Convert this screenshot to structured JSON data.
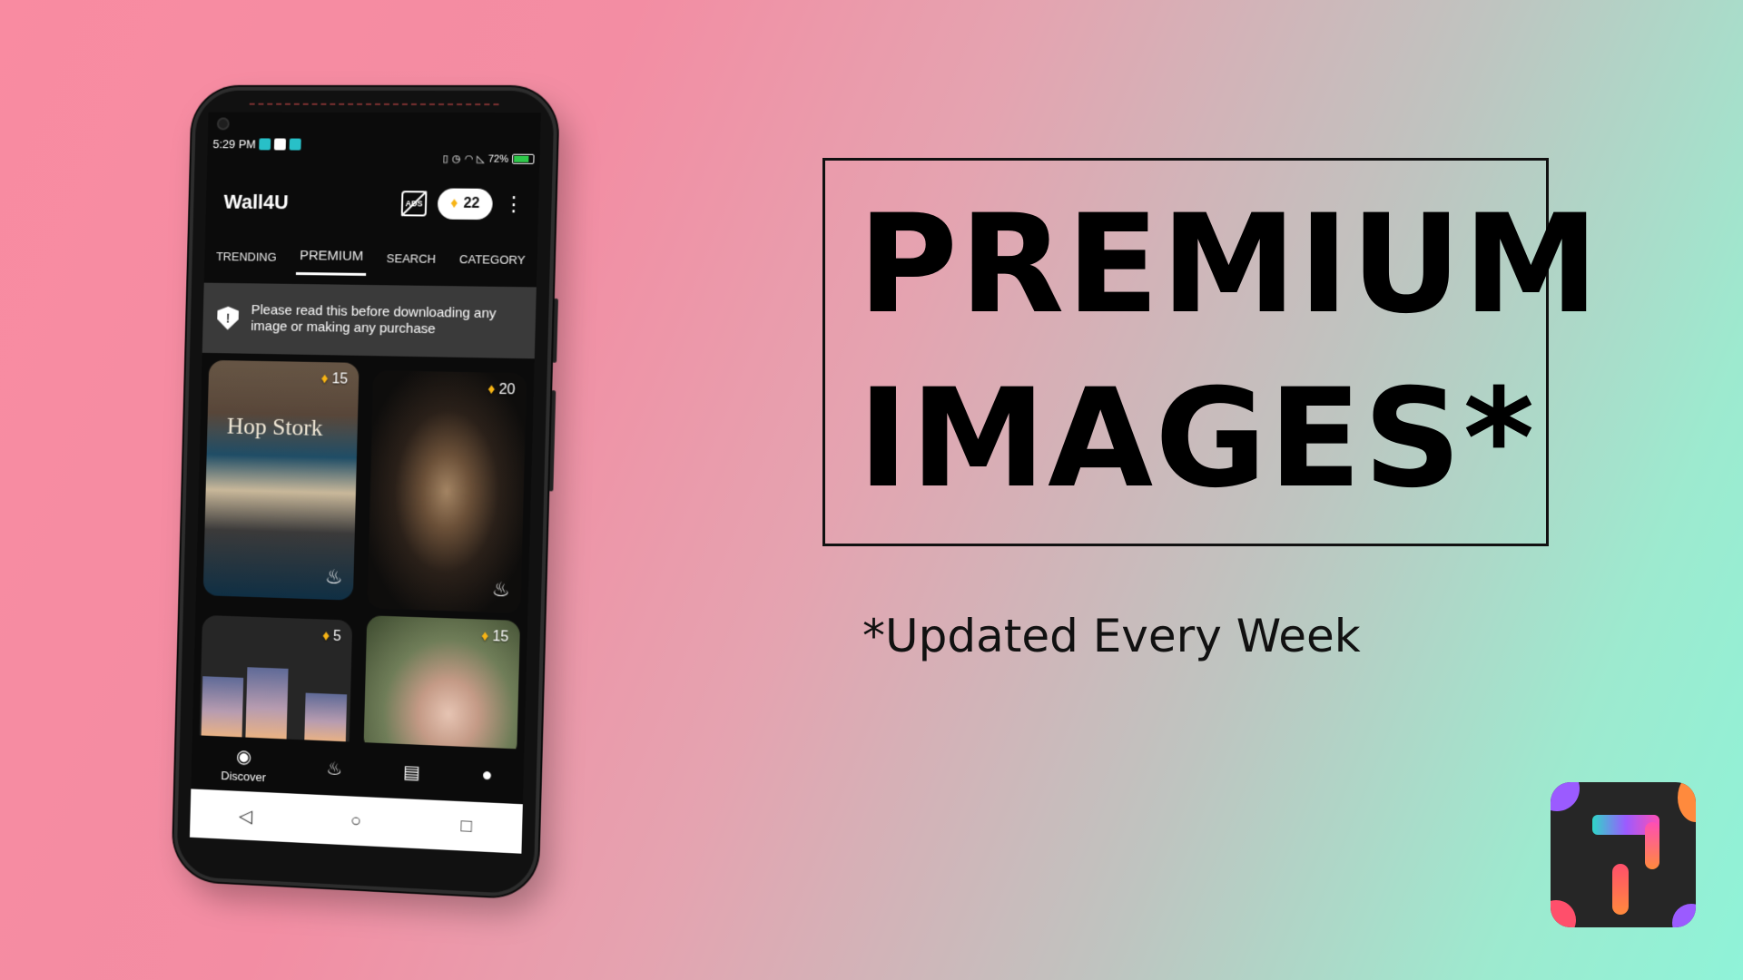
{
  "status_bar": {
    "time": "5:29 PM",
    "battery": "72%"
  },
  "app": {
    "title": "Wall4U",
    "no_ads_label": "ADS",
    "gems": "22",
    "tabs": [
      "TRENDING",
      "PREMIUM",
      "SEARCH",
      "CATEGORY"
    ],
    "active_tab": "PREMIUM",
    "notice": "Please read this before downloading any image or making any purchase",
    "cards": [
      {
        "price": "15",
        "sign": "Hop Stork"
      },
      {
        "price": "20"
      },
      {
        "price": "5"
      },
      {
        "price": "15"
      }
    ],
    "bottom_nav": [
      "Discover"
    ]
  },
  "promo": {
    "line1": "PREMIUM",
    "line2": "IMAGES*",
    "subtext": "*Updated Every Week"
  },
  "colors": {
    "gem": "#f7b415",
    "battery": "#2ec84a",
    "bg_start": "#f98ba1",
    "bg_end": "#8ff3d8"
  }
}
